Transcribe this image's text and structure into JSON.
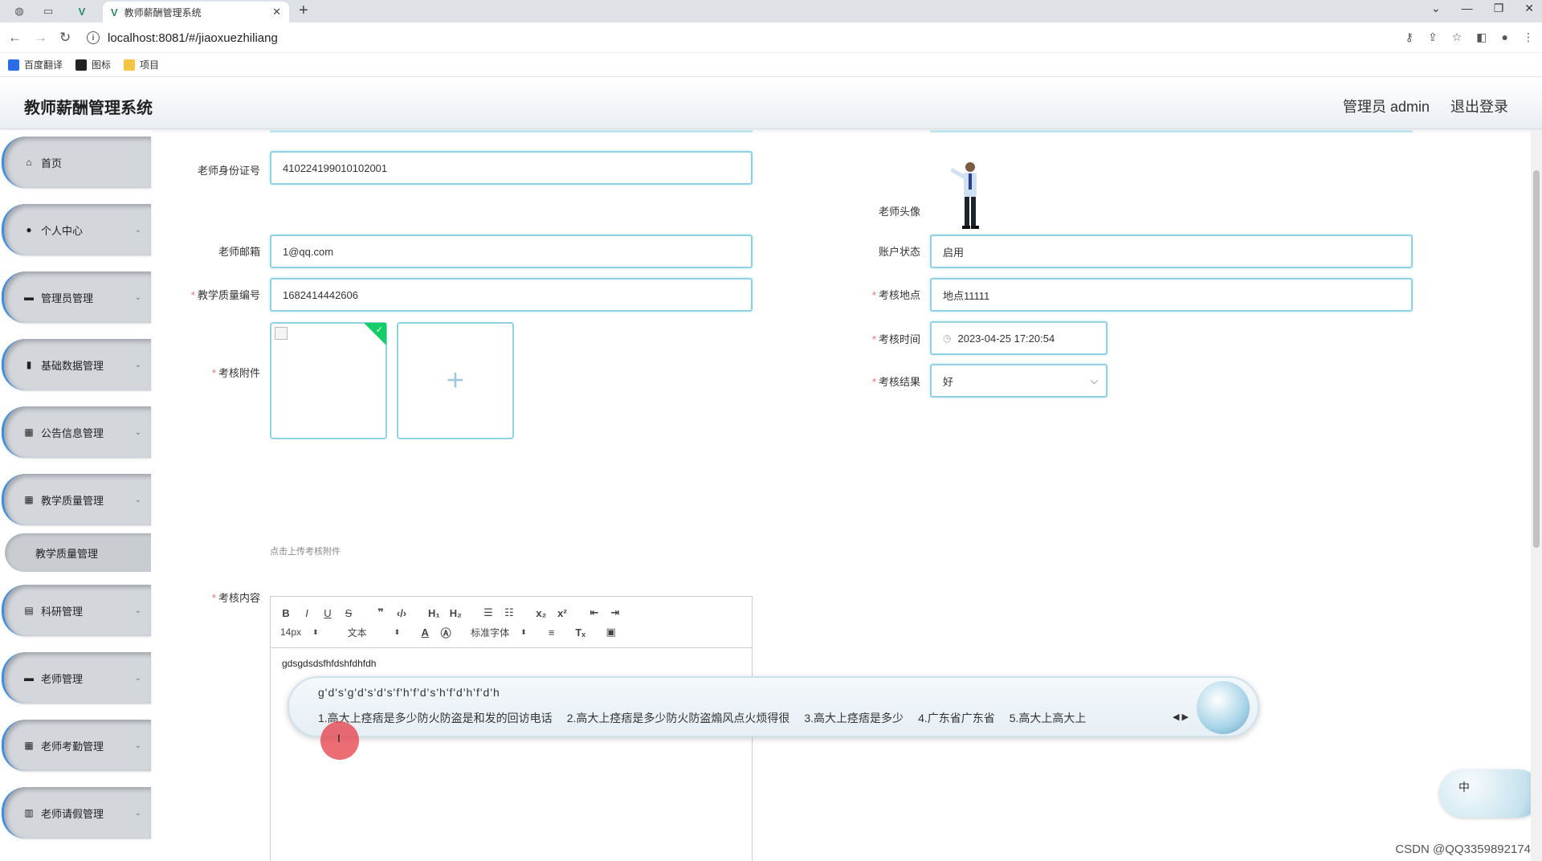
{
  "browser": {
    "tab_title": "教师薪酬管理系统",
    "url": "localhost:8081/#/jiaoxuezhiliang",
    "bookmarks": [
      "百度翻译",
      "图标",
      "项目"
    ]
  },
  "header": {
    "title": "教师薪酬管理系统",
    "user": "管理员 admin",
    "logout": "退出登录"
  },
  "sidebar": {
    "items": [
      {
        "label": "首页",
        "icon": "home-icon"
      },
      {
        "label": "个人中心",
        "icon": "user-icon"
      },
      {
        "label": "管理员管理",
        "icon": "briefcase-icon"
      },
      {
        "label": "基础数据管理",
        "icon": "document-icon"
      },
      {
        "label": "公告信息管理",
        "icon": "grid-icon"
      },
      {
        "label": "教学质量管理",
        "icon": "grid-icon"
      },
      {
        "label": "科研管理",
        "icon": "clipboard-icon"
      },
      {
        "label": "老师管理",
        "icon": "monitor-icon"
      },
      {
        "label": "老师考勤管理",
        "icon": "grid-icon"
      },
      {
        "label": "老师请假管理",
        "icon": "chart-icon"
      }
    ],
    "submenu": "教学质量管理"
  },
  "form": {
    "id_label": "老师身份证号",
    "id_value": "410224199010102001",
    "avatar_label": "老师头像",
    "email_label": "老师邮箱",
    "email_value": "1@qq.com",
    "status_label": "账户状态",
    "status_value": "启用",
    "code_label": "教学质量编号",
    "code_value": "1682414442606",
    "location_label": "考核地点",
    "location_value": "地点11111",
    "attachment_label": "考核附件",
    "time_label": "考核时间",
    "time_value": "2023-04-25 17:20:54",
    "result_label": "考核结果",
    "result_value": "好",
    "upload_hint": "点击上传考核附件",
    "content_label": "考核内容"
  },
  "editor": {
    "font_size": "14px",
    "text_style": "文本",
    "font_family": "标准字体",
    "content": "gdsgdsdsfhfdshfdhfdh"
  },
  "ime": {
    "composition": "g'd's'g'd's'd's'f'h'f'd's'h'f'd'h'f'd'h",
    "candidates": [
      "1.高大上痉痞是多少防火防盗是和发的回访电话",
      "2.高大上痉痞是多少防火防盗煽风点火烦得很",
      "3.高大上痉痞是多少",
      "4.广东省广东省",
      "5.高大上高大上"
    ],
    "status": "中"
  },
  "watermark": "CSDN @QQ3359892174"
}
